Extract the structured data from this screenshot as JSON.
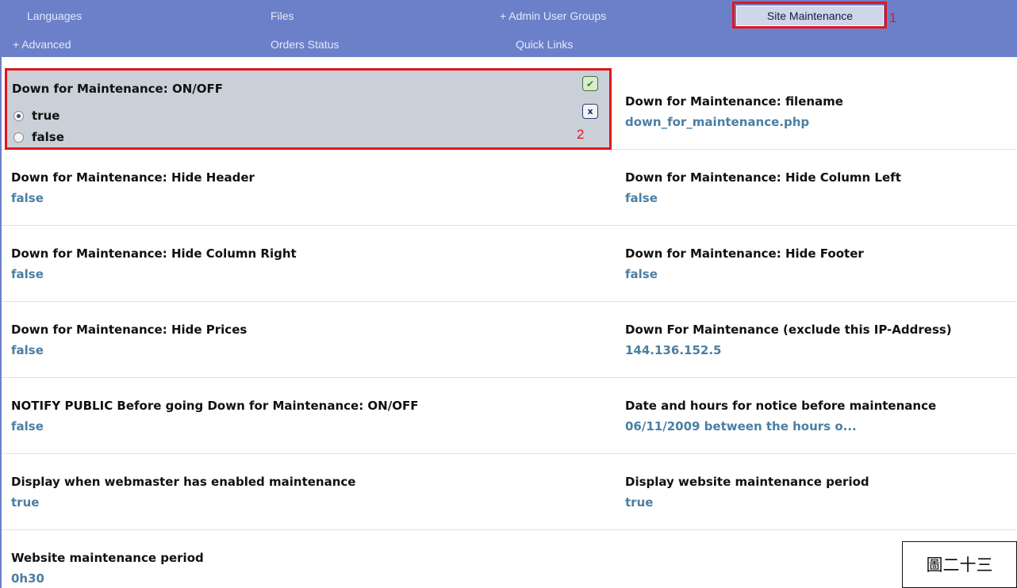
{
  "nav": {
    "items": [
      {
        "label": "Languages"
      },
      {
        "label": "Files"
      },
      {
        "label": "+ Admin User Groups"
      },
      {
        "label": "+ Advanced"
      },
      {
        "label": "Orders Status"
      },
      {
        "label": "Quick Links"
      }
    ],
    "active_label": "Site Maintenance",
    "annotation": "1"
  },
  "editor": {
    "title": "Down for Maintenance: ON/OFF",
    "options": [
      {
        "label": "true",
        "selected": true
      },
      {
        "label": "false",
        "selected": false
      }
    ],
    "save_icon": "✔",
    "cancel_icon": "x",
    "annotation": "2"
  },
  "settings": [
    {
      "title": "Down for Maintenance: filename",
      "value": "down_for_maintenance.php"
    },
    {
      "title": "Down for Maintenance: Hide Header",
      "value": "false"
    },
    {
      "title": "Down for Maintenance: Hide Column Left",
      "value": "false"
    },
    {
      "title": "Down for Maintenance: Hide Column Right",
      "value": "false"
    },
    {
      "title": "Down for Maintenance: Hide Footer",
      "value": "false"
    },
    {
      "title": "Down for Maintenance: Hide Prices",
      "value": "false"
    },
    {
      "title": "Down For Maintenance (exclude this IP-Address)",
      "value": "144.136.152.5"
    },
    {
      "title": "NOTIFY PUBLIC Before going Down for Maintenance: ON/OFF",
      "value": "false"
    },
    {
      "title": "Date and hours for notice before maintenance",
      "value": "06/11/2009 between the hours o..."
    },
    {
      "title": "Display when webmaster has enabled maintenance",
      "value": "true"
    },
    {
      "title": "Display website maintenance period",
      "value": "true"
    },
    {
      "title": "Website maintenance period",
      "value": "0h30"
    }
  ],
  "caption": "圖二十三",
  "colors": {
    "nav_bg": "#6b80c9",
    "annotation_red": "#e0161d",
    "value_blue": "#4a7fa3",
    "editor_bg": "#c9d0d8"
  }
}
